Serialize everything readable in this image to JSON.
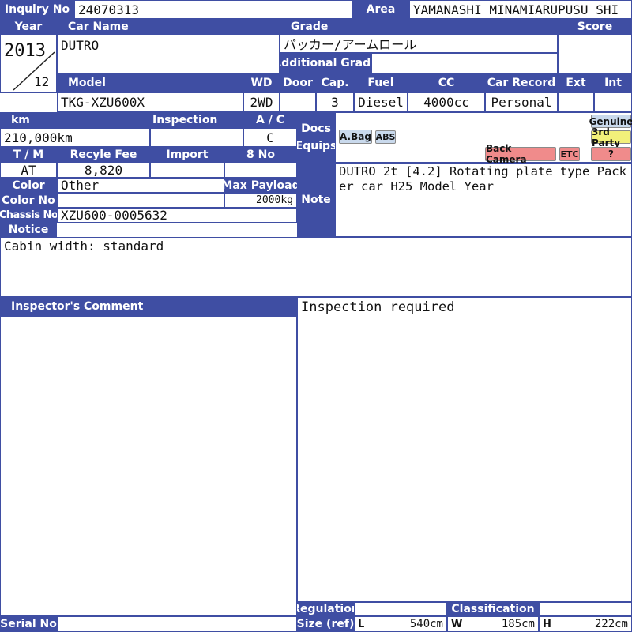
{
  "labels": {
    "inquiry_no": "Inquiry No",
    "area": "Area",
    "year": "Year",
    "car_name": "Car Name",
    "grade": "Grade",
    "score": "Score",
    "additional_grade": "Additional Grade",
    "model": "Model",
    "wd": "WD",
    "door": "Door",
    "cap": "Cap.",
    "fuel": "Fuel",
    "cc": "CC",
    "car_record": "Car Record",
    "ext": "Ext",
    "int": "Int",
    "km": "km",
    "inspection": "Inspection",
    "ac": "A / C",
    "docs": "Docs",
    "equips": "Equips",
    "tm": "T / M",
    "recycle_fee": "Recyle Fee",
    "import": "Import",
    "eight_no": "8 No",
    "color": "Color",
    "max_payload": "Max Payload",
    "color_no": "Color No",
    "note": "Note",
    "chassis_no": "Chassis No",
    "notice": "Notice",
    "inspectors_comment": "Inspector's Comment",
    "regulation": "Regulation",
    "size_ref": "Size (ref)",
    "classification": "Classification",
    "serial_no": "Serial No",
    "dim_l": "L",
    "dim_w": "W",
    "dim_h": "H"
  },
  "values": {
    "inquiry_no": "24070313",
    "area": "YAMANASHI MINAMIARUPUSU SHI",
    "year": "2013",
    "month": "12",
    "car_name": "DUTRO",
    "grade": "パッカー/アームロール",
    "additional_grade": "",
    "score": "",
    "model": "TKG-XZU600X",
    "wd": "2WD",
    "door": "",
    "cap": "3",
    "fuel": "Diesel",
    "cc": "4000cc",
    "car_record": "Personal",
    "ext": "",
    "int": "",
    "km": "210,000km",
    "inspection": "",
    "ac": "C",
    "tm": "AT",
    "recycle_fee": "8,820",
    "import": "",
    "eight_no": "",
    "color": "Other",
    "max_payload": "2000kg",
    "color_no": "",
    "chassis_no": "XZU600-0005632",
    "note": "DUTRO 2t [4.2] Rotating plate type Packer car H25 Model Year",
    "notice": "Cabin width: standard",
    "inspectors_comment_left": "",
    "inspection_required": "Inspection required",
    "regulation": "",
    "classification": "",
    "serial_no": "",
    "size_l": "540cm",
    "size_w": "185cm",
    "size_h": "222cm"
  },
  "equip_tags": {
    "airbag": "A.Bag",
    "abs": "ABS",
    "back_camera": "Back Camera",
    "etc": "ETC",
    "genuine": "Genuine",
    "third_party": "3rd Party",
    "unknown": "?"
  },
  "colors": {
    "header_blue": "#3f4ea3",
    "tag_blue": "#c9d9ec",
    "tag_yellow": "#f2f07a",
    "tag_pink": "#f08b8b"
  }
}
